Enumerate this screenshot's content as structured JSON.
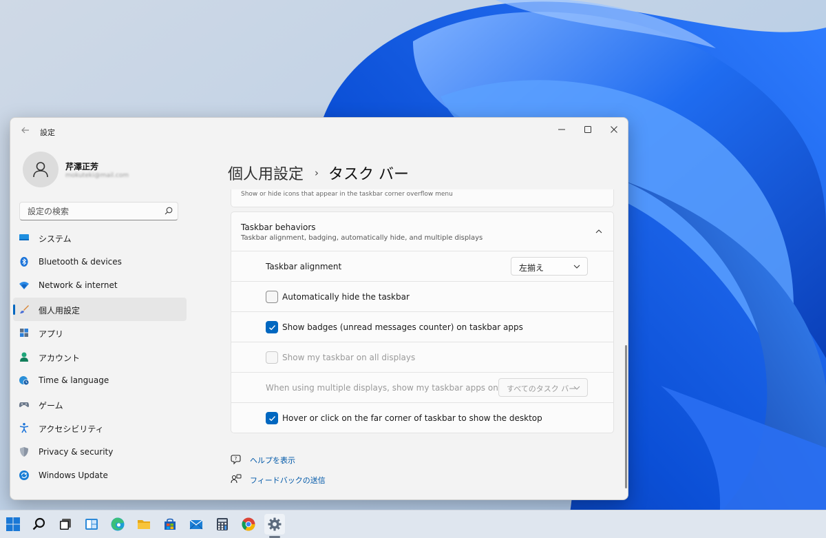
{
  "window": {
    "app_title": "設定",
    "controls": {
      "minimize": "minimize",
      "maximize": "maximize",
      "close": "close"
    }
  },
  "user": {
    "name": "芹澤正芳",
    "email": "mokuteki@mail.com"
  },
  "search": {
    "placeholder": "設定の検索"
  },
  "sidebar": {
    "items": [
      {
        "label": "システム",
        "icon": "display-icon",
        "active": false
      },
      {
        "label": "Bluetooth & devices",
        "icon": "bluetooth-icon",
        "active": false
      },
      {
        "label": "Network & internet",
        "icon": "wifi-icon",
        "active": false
      },
      {
        "label": "個人用設定",
        "icon": "brush-icon",
        "active": true
      },
      {
        "label": "アプリ",
        "icon": "apps-icon",
        "active": false
      },
      {
        "label": "アカウント",
        "icon": "person-icon",
        "active": false
      },
      {
        "label": "Time & language",
        "icon": "globe-clock-icon",
        "active": false
      },
      {
        "label": "ゲーム",
        "icon": "gamepad-icon",
        "active": false
      },
      {
        "label": "アクセシビリティ",
        "icon": "accessibility-icon",
        "active": false
      },
      {
        "label": "Privacy & security",
        "icon": "shield-icon",
        "active": false
      },
      {
        "label": "Windows Update",
        "icon": "update-icon",
        "active": false
      }
    ]
  },
  "main": {
    "breadcrumb": {
      "parent": "個人用設定",
      "separator": "›",
      "current": "タスク バー"
    },
    "previous_card_text": "Show or hide icons that appear in the taskbar corner overflow menu",
    "section": {
      "title": "Taskbar behaviors",
      "description": "Taskbar alignment, badging, automatically hide, and multiple displays"
    },
    "settings": {
      "alignment": {
        "label": "Taskbar alignment",
        "value": "左揃え"
      },
      "auto_hide": {
        "label": "Automatically hide the taskbar",
        "checked": false
      },
      "badges": {
        "label": "Show badges (unread messages counter) on taskbar apps",
        "checked": true
      },
      "all_displays": {
        "label": "Show my taskbar on all displays",
        "checked": false,
        "disabled": true
      },
      "multi_display": {
        "label": "When using multiple displays, show my taskbar apps on",
        "value": "すべてのタスク バー",
        "disabled": true
      },
      "show_desktop": {
        "label": "Hover or click on the far corner of taskbar to show the desktop",
        "checked": true
      }
    },
    "links": {
      "help": "ヘルプを表示",
      "feedback": "フィードバックの送信"
    }
  },
  "taskbar": {
    "icons": [
      "start-icon",
      "search-icon",
      "task-view-icon",
      "widgets-icon",
      "edge-icon",
      "file-explorer-icon",
      "store-icon",
      "mail-icon",
      "calculator-icon",
      "chrome-icon",
      "settings-icon"
    ],
    "active": "settings-icon"
  },
  "colors": {
    "accent": "#0067c0",
    "wallpaper_blue": "#1565e6",
    "window_bg": "#f3f3f3"
  }
}
